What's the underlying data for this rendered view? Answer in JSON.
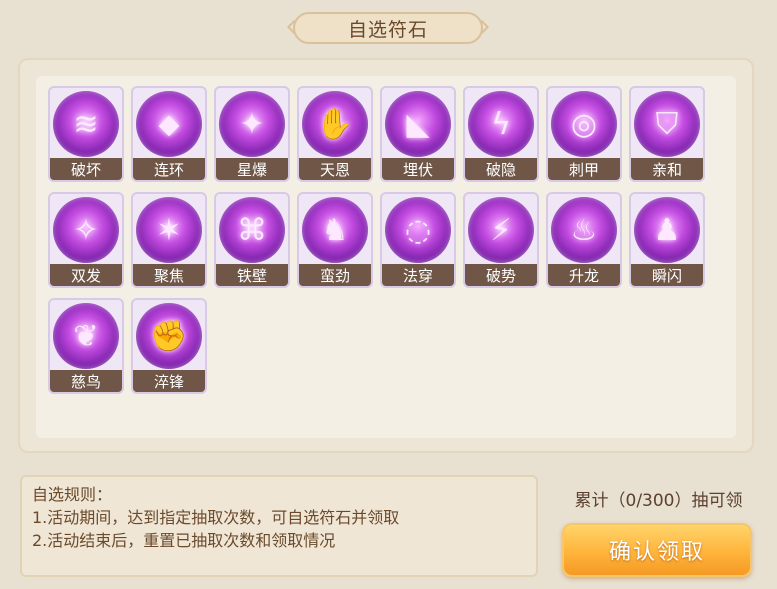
{
  "title": "自选符石",
  "runes": [
    {
      "label": "破坏",
      "icon": "claw-slash-icon",
      "glyph": "≋"
    },
    {
      "label": "连环",
      "icon": "crystal-sword-icon",
      "glyph": "⬥"
    },
    {
      "label": "星爆",
      "icon": "star-burst-icon",
      "glyph": "✦"
    },
    {
      "label": "天恩",
      "icon": "flame-hand-icon",
      "glyph": "✋"
    },
    {
      "label": "埋伏",
      "icon": "shadow-face-icon",
      "glyph": "◣"
    },
    {
      "label": "破隐",
      "icon": "demon-lightning-icon",
      "glyph": "ϟ"
    },
    {
      "label": "刺甲",
      "icon": "spiral-spike-icon",
      "glyph": "◎"
    },
    {
      "label": "亲和",
      "icon": "shield-icon",
      "glyph": "⛉"
    },
    {
      "label": "双发",
      "icon": "double-shot-icon",
      "glyph": "✧"
    },
    {
      "label": "聚焦",
      "icon": "focus-star-icon",
      "glyph": "✶"
    },
    {
      "label": "铁壁",
      "icon": "iron-wall-icon",
      "glyph": "⌘"
    },
    {
      "label": "蛮劲",
      "icon": "brute-warrior-icon",
      "glyph": "♞"
    },
    {
      "label": "法穿",
      "icon": "magic-pierce-icon",
      "glyph": "◌"
    },
    {
      "label": "破势",
      "icon": "demon-strike-icon",
      "glyph": "⚡"
    },
    {
      "label": "升龙",
      "icon": "rising-demon-icon",
      "glyph": "♨"
    },
    {
      "label": "瞬闪",
      "icon": "blink-demon-icon",
      "glyph": "♟"
    },
    {
      "label": "慈鸟",
      "icon": "phoenix-icon",
      "glyph": "❦"
    },
    {
      "label": "淬锋",
      "icon": "tempered-fist-icon",
      "glyph": "✊"
    }
  ],
  "rules": {
    "heading": "自选规则：",
    "line1": "1.活动期间，达到指定抽取次数，可自选符石并领取",
    "line2": "2.活动结束后，重置已抽取次数和领取情况"
  },
  "progress": {
    "text": "累计（0/300）抽可领",
    "current": 0,
    "target": 300
  },
  "confirm_label": "确认领取",
  "colors": {
    "background": "#e8e0d0",
    "label_bar": "#6f5646",
    "button": "#ffb43c",
    "text_brown": "#6b4a2c"
  }
}
